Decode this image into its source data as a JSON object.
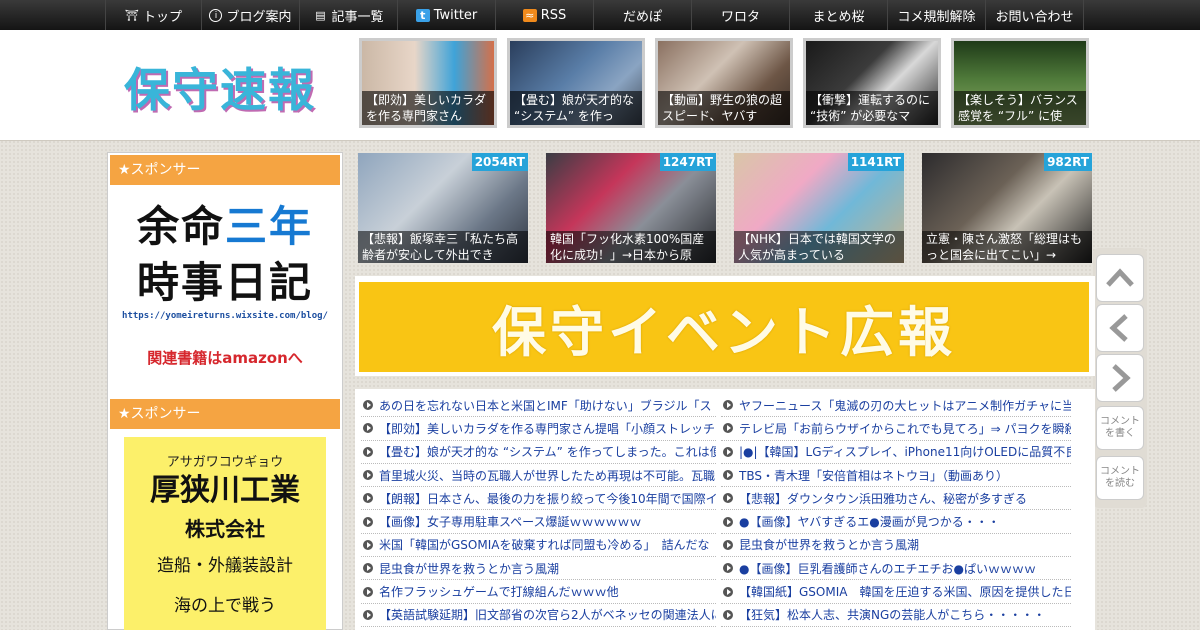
{
  "nav": [
    {
      "label": "トップ",
      "icon": "home-icon"
    },
    {
      "label": "ブログ案内",
      "icon": "info-icon"
    },
    {
      "label": "記事一覧",
      "icon": "list-icon"
    },
    {
      "label": "Twitter",
      "icon": "twitter-icon"
    },
    {
      "label": "RSS",
      "icon": "rss-icon"
    },
    {
      "label": "だめぽ"
    },
    {
      "label": "ワロタ"
    },
    {
      "label": "まとめ桜"
    },
    {
      "label": "コメ規制解除"
    },
    {
      "label": "お問い合わせ"
    }
  ],
  "logo": "保守速報",
  "header_thumbs": [
    "【即効】美しいカラダを作る専門家さん",
    "【畳む】娘が天才的な “システム” を作っ",
    "【動画】野生の狼の超スピード、ヤバす",
    "【衝撃】運転するのに “技術” が必要なマ",
    "【楽しそう】バランス感覚を “フル” に使"
  ],
  "sidebar": {
    "sponsor_label": "★スポンサー",
    "ad1": {
      "line1_a": "余命",
      "line1_b": "三年",
      "line2": "時事日記",
      "url": "https://yomeireturns.wixsite.com/blog/",
      "amazon": "関連書籍はamazonへ"
    },
    "ad2": {
      "kana": "アサガワコウギョウ",
      "name": "厚狭川工業",
      "corp": "株式会社",
      "desc1": "造船・外艤装設計",
      "desc2": "海の上で戦う"
    }
  },
  "rt_thumbs": [
    {
      "count": "2054RT",
      "caption": "【悲報】飯塚幸三「私たち高齢者が安心して外出でき"
    },
    {
      "count": "1247RT",
      "caption": "韓国「フッ化水素100%国産化に成功！」→日本から原"
    },
    {
      "count": "1141RT",
      "caption": "【NHK】日本では韓国文学の人気が高まっている"
    },
    {
      "count": "982RT",
      "caption": "立憲・陳さん激怒「総理はもっと国会に出てこい」→"
    }
  ],
  "side_buttons": {
    "comment_write": "コメントを書く",
    "comment_read": "コメントを読む"
  },
  "banner": "保守イベント広報",
  "list_left": [
    "あの日を忘れない日本と米国とIMF「助けない」ブラジル「ス",
    "【即効】美しいカラダを作る専門家さん提唱「小顔ストレッチ",
    "【畳む】娘が天才的な “システム” を作ってしまった。これは便",
    "首里城火災、当時の瓦職人が世界したため再現は不可能。瓦職",
    "【朗報】日本さん、最後の力を振り絞って今後10年間で国際イ",
    "【画像】女子専用駐車スペース爆誕ｗｗｗｗｗｗ",
    "米国「韓国がGSOMIAを破棄すれば同盟も冷める」　詰んだな",
    "昆虫食が世界を救うとか言う風潮",
    "名作フラッシュゲームで打線組んだｗｗｗ他",
    "【英語試験延期】旧文部省の次官ら2人がベネッセの関連法人に"
  ],
  "list_right": [
    "ヤフーニュース「鬼滅の刃の大ヒットはアニメ制作ガチャに当",
    "テレビ局「お前らウザイからこれでも見てろ」⇒ パヨクを瞬殺",
    "|●|【韓国】LGディスプレイ、iPhone11向けOLEDに品質不良発生",
    "TBS・青木理「安倍首相はネトウヨ」（動画あり）",
    "【悲報】ダウンタウン浜田雅功さん、秘密が多すぎる",
    "●【画像】ヤバすぎるエ●漫画が見つかる・・・",
    "昆虫食が世界を救うとか言う風潮",
    "●【画像】巨乳看護師さんのエチエチお●ぱいｗｗｗｗ",
    "【韓国紙】GSOMIA　韓国を圧迫する米国、原因を提供した日",
    "【狂気】松本人志、共演NGの芸能人がこちら・・・・・"
  ]
}
